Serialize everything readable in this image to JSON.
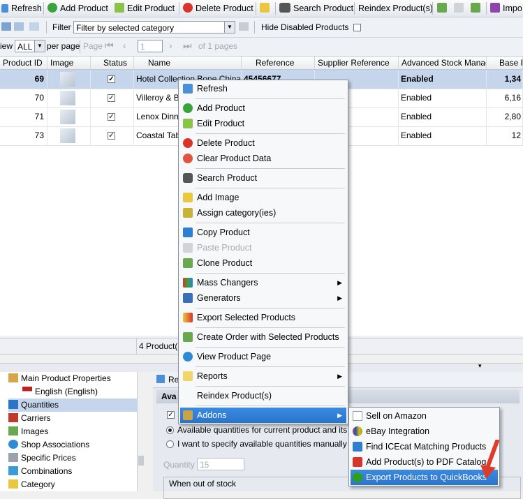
{
  "toolbar": {
    "refresh": "Refresh",
    "add_product": "Add Product",
    "edit_product": "Edit Product",
    "delete_product": "Delete Product",
    "search_product": "Search Product",
    "reindex": "Reindex Product(s)",
    "import": "Impo"
  },
  "filter_bar": {
    "filter_label": "Filter",
    "filter_value": "Filter by selected category",
    "hide_disabled": "Hide Disabled Products"
  },
  "paging": {
    "view_label": "iew",
    "per_page_value": "ALL",
    "per_page_label": "per page",
    "page_label": "Page",
    "page_value": "1",
    "of_pages": "of 1 pages"
  },
  "grid": {
    "columns": [
      "Product ID",
      "Image",
      "Status",
      "Name",
      "Reference",
      "Supplier Reference",
      "Advanced Stock Manage",
      "Base P"
    ],
    "rows": [
      {
        "id": "69",
        "name": "Hotel Collection Bone China Ho",
        "reference": "45456677",
        "asm": "Enabled",
        "price": "1,34"
      },
      {
        "id": "70",
        "name": "Villeroy & Bo",
        "reference": "",
        "asm": "Enabled",
        "price": "6,16"
      },
      {
        "id": "71",
        "name": "Lenox Dinne",
        "reference": "",
        "asm": "Enabled",
        "price": "2,80"
      },
      {
        "id": "73",
        "name": "Coastal Tabl",
        "reference": "",
        "asm": "Enabled",
        "price": "12"
      }
    ],
    "count": "4 Product(s)"
  },
  "tree": {
    "items": [
      "Main Product Properties",
      "English (English)",
      "Quantities",
      "Carriers",
      "Images",
      "Shop Associations",
      "Specific Prices",
      "Combinations",
      "Category"
    ]
  },
  "right_pane": {
    "refresh_partial": "Re",
    "section_partial": "Ava",
    "radio1": "Available quantities for current product and its con",
    "radio2": "I want to specify available quantities manually",
    "quantity_label": "Quantity",
    "quantity_value": "15",
    "out_of_stock": "When out of stock"
  },
  "context_menu": {
    "items": [
      "Refresh",
      "Add Product",
      "Edit Product",
      "Delete Product",
      "Clear Product Data",
      "Search Product",
      "Add Image",
      "Assign category(ies)",
      "Copy Product",
      "Paste Product",
      "Clone Product",
      "Mass Changers",
      "Generators",
      "Export Selected Products",
      "Create Order with Selected Products",
      "View Product Page",
      "Reports",
      "Reindex Product(s)",
      "Addons"
    ]
  },
  "addons_menu": {
    "items": [
      "Sell on Amazon",
      "eBay Integration",
      "Find ICEcat Matching Products",
      "Add Product(s) to PDF Catalog",
      "Export Products to QuickBooks"
    ]
  },
  "colors": {
    "highlight": "#2a74cc",
    "selected_row": "#c5d6ec",
    "arrow_annotation": "#e03a2a"
  }
}
